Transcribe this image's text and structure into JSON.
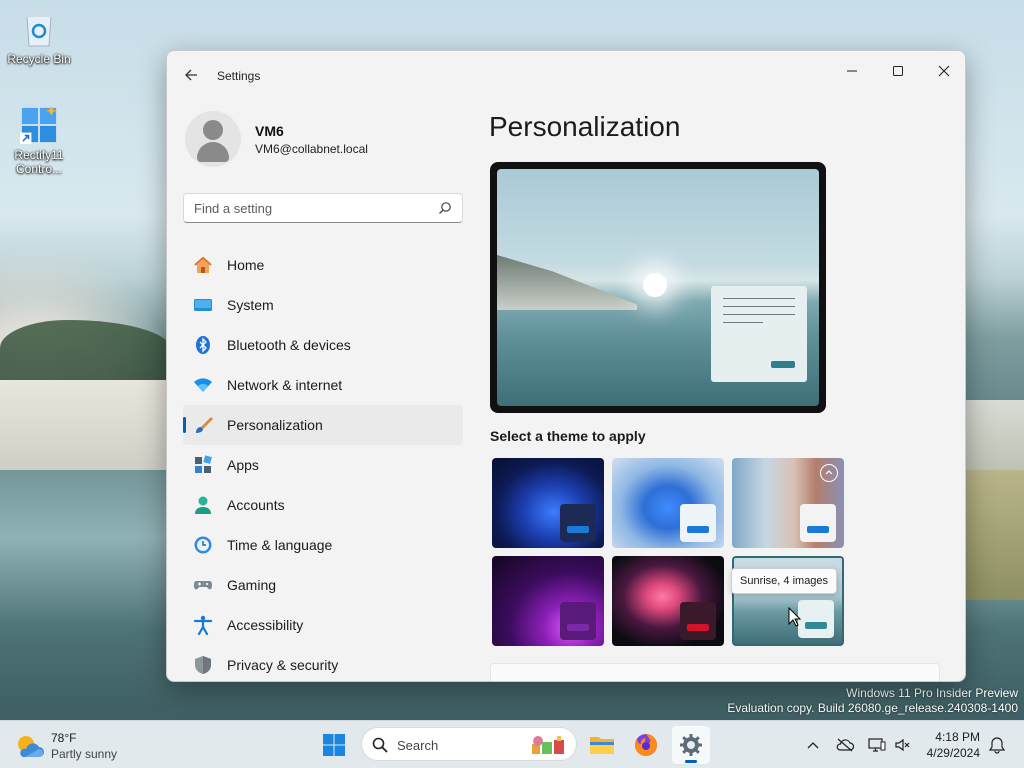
{
  "desktop": {
    "icons": [
      {
        "label": "Recycle Bin",
        "icon": "recycle-bin-icon"
      },
      {
        "label": "Rectify11 Contro...",
        "icon": "control-panel-icon"
      }
    ],
    "watermark": {
      "line1": "Windows 11 Pro Insider Preview",
      "line2": "Evaluation copy. Build 26080.ge_release.240308-1400"
    }
  },
  "window": {
    "title": "Settings",
    "controls": {
      "minimize": "—",
      "maximize": "☐",
      "close": "✕"
    }
  },
  "profile": {
    "name": "VM6",
    "email": "VM6@collabnet.local"
  },
  "search": {
    "placeholder": "Find a setting"
  },
  "nav": {
    "items": [
      {
        "label": "Home",
        "icon": "home-icon"
      },
      {
        "label": "System",
        "icon": "system-icon"
      },
      {
        "label": "Bluetooth & devices",
        "icon": "bluetooth-icon"
      },
      {
        "label": "Network & internet",
        "icon": "wifi-icon"
      },
      {
        "label": "Personalization",
        "icon": "brush-icon",
        "active": true
      },
      {
        "label": "Apps",
        "icon": "apps-icon"
      },
      {
        "label": "Accounts",
        "icon": "accounts-icon"
      },
      {
        "label": "Time & language",
        "icon": "clock-globe-icon"
      },
      {
        "label": "Gaming",
        "icon": "gamepad-icon"
      },
      {
        "label": "Accessibility",
        "icon": "accessibility-icon"
      },
      {
        "label": "Privacy & security",
        "icon": "shield-icon"
      }
    ]
  },
  "content": {
    "title": "Personalization",
    "theme_heading": "Select a theme to apply",
    "themes": [
      {
        "name": "windows-dark-theme"
      },
      {
        "name": "windows-light-theme"
      },
      {
        "name": "spotlight-theme"
      },
      {
        "name": "glow-theme"
      },
      {
        "name": "captured-motion-theme"
      },
      {
        "name": "sunrise-theme",
        "selected": true
      }
    ],
    "tooltip": "Sunrise, 4 images"
  },
  "taskbar": {
    "weather": {
      "temp": "78°F",
      "condition": "Partly sunny"
    },
    "search_label": "Search",
    "clock": {
      "time": "4:18 PM",
      "date": "4/29/2024"
    }
  },
  "colors": {
    "accent": "#005fb8"
  }
}
